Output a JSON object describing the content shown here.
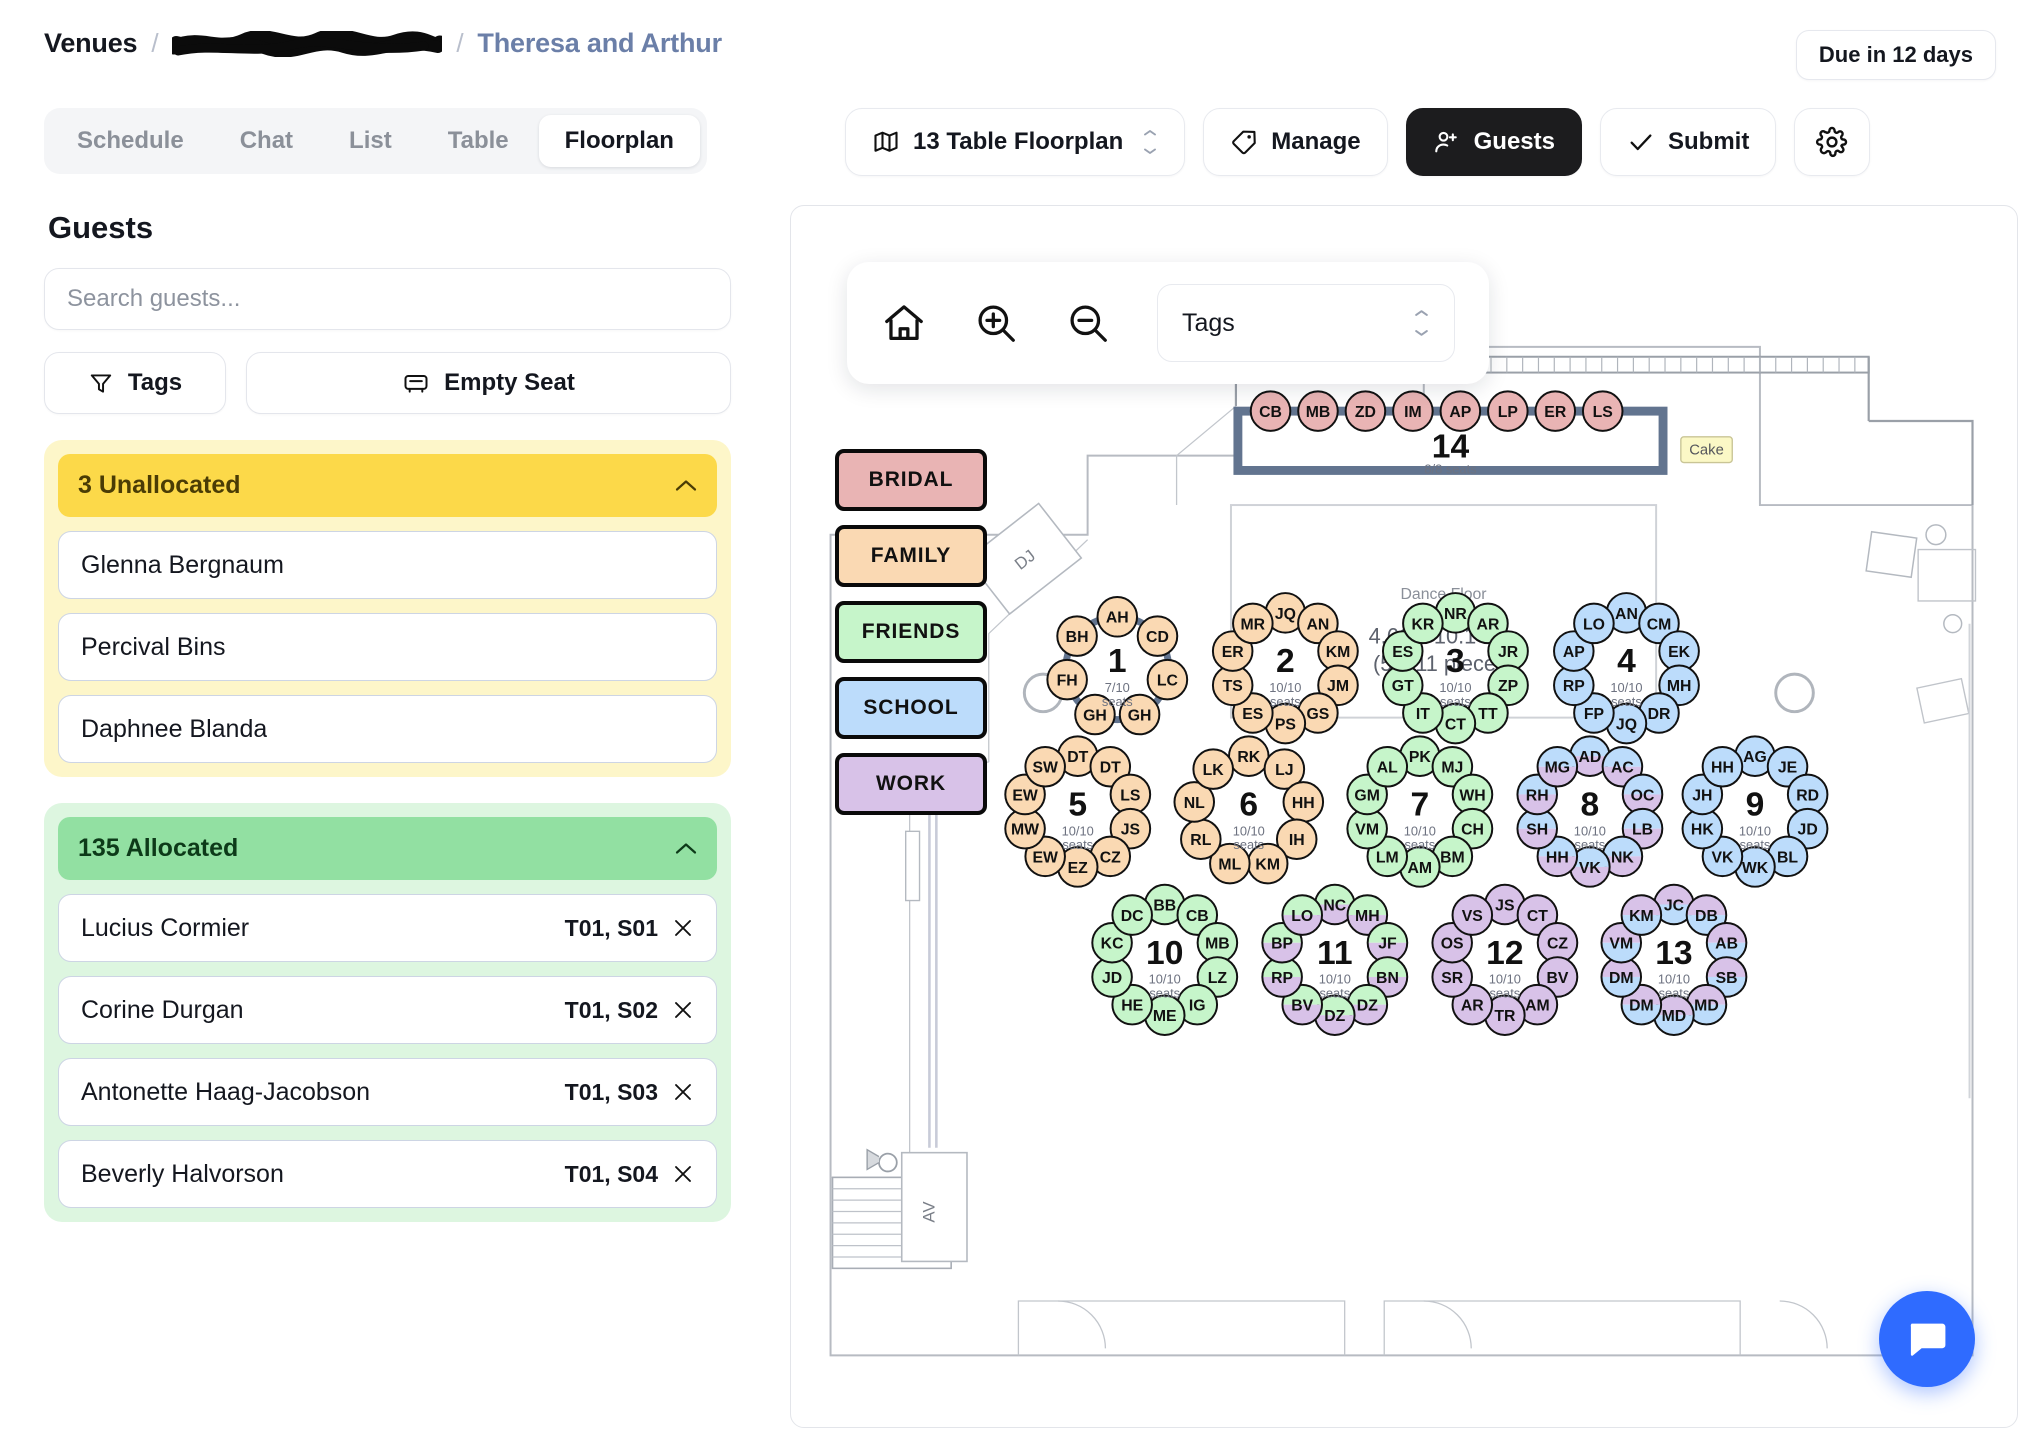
{
  "header": {
    "breadcrumb": {
      "root": "Venues",
      "separator": "/",
      "redacted_label": "",
      "current": "Theresa and Arthur"
    },
    "due_badge": "Due in 12 days"
  },
  "tabs": [
    {
      "label": "Schedule",
      "active": false
    },
    {
      "label": "Chat",
      "active": false
    },
    {
      "label": "List",
      "active": false
    },
    {
      "label": "Table",
      "active": false
    },
    {
      "label": "Floorplan",
      "active": true
    }
  ],
  "toolbar": {
    "floorplan_select": "13 Table Floorplan",
    "manage": "Manage",
    "guests": "Guests",
    "submit": "Submit",
    "settings_icon": "gear-icon"
  },
  "sidebar": {
    "title": "Guests",
    "search_placeholder": "Search guests...",
    "search_value": "",
    "tags_button": "Tags",
    "empty_seat_button": "Empty Seat",
    "unallocated": {
      "header": "3 Unallocated",
      "count": 3,
      "guests": [
        {
          "name": "Glenna Bergnaum"
        },
        {
          "name": "Percival Bins"
        },
        {
          "name": "Daphnee Blanda"
        }
      ]
    },
    "allocated": {
      "header": "135 Allocated",
      "count": 135,
      "guests": [
        {
          "name": "Lucius Cormier",
          "seat": "T01, S01"
        },
        {
          "name": "Corine Durgan",
          "seat": "T01, S02"
        },
        {
          "name": "Antonette Haag-Jacobson",
          "seat": "T01, S03"
        },
        {
          "name": "Beverly Halvorson",
          "seat": "T01, S04"
        }
      ]
    }
  },
  "floorplan": {
    "toolbar": {
      "home_icon": "home-icon",
      "zoom_in_icon": "zoom-in-icon",
      "zoom_out_icon": "zoom-out-icon",
      "tags_select": "Tags"
    },
    "legend": [
      {
        "label": "BRIDAL",
        "color": "#e9b4b4"
      },
      {
        "label": "FAMILY",
        "color": "#fad9b3"
      },
      {
        "label": "FRIENDS",
        "color": "#c6f5ca"
      },
      {
        "label": "SCHOOL",
        "color": "#bcdcfb"
      },
      {
        "label": "WORK",
        "color": "#d8c2e8"
      }
    ],
    "room_labels": [
      {
        "text": "DJ"
      },
      {
        "text": "AV"
      },
      {
        "text": "Cake"
      }
    ],
    "dance_floor": {
      "title": "Dance Floor",
      "dimensions": "4.61 x 10.142m",
      "pieces": "(5 x 11 pieces)"
    },
    "tables": [
      {
        "number": "1",
        "seats_label": "7/10 seats",
        "filled": 7,
        "capacity": 10,
        "shape": "round",
        "seats": [
          "AH",
          "CD",
          "LC",
          "GH",
          "GH",
          "FH",
          "BH"
        ],
        "colors": [
          "#fad9b3"
        ]
      },
      {
        "number": "2",
        "seats_label": "10/10 seats",
        "filled": 10,
        "capacity": 10,
        "shape": "round",
        "seats": [
          "JQ",
          "AN",
          "KM",
          "JM",
          "GS",
          "PS",
          "ES",
          "TS",
          "ER",
          "MR"
        ],
        "colors": [
          "#fad9b3"
        ]
      },
      {
        "number": "3",
        "seats_label": "10/10 seats",
        "filled": 10,
        "capacity": 10,
        "shape": "round",
        "seats": [
          "NR",
          "AR",
          "JR",
          "ZP",
          "TT",
          "CT",
          "IT",
          "GT",
          "ES",
          "KR"
        ],
        "colors": [
          "#c6f5ca"
        ]
      },
      {
        "number": "4",
        "seats_label": "10/10 seats",
        "filled": 10,
        "capacity": 10,
        "shape": "round",
        "seats": [
          "AN",
          "CM",
          "EK",
          "MH",
          "DR",
          "JQ",
          "FP",
          "RP",
          "AP",
          "LO"
        ],
        "colors": [
          "#bcdcfb"
        ]
      },
      {
        "number": "5",
        "seats_label": "10/10 seats",
        "filled": 10,
        "capacity": 10,
        "shape": "round",
        "seats": [
          "DT",
          "DT",
          "LS",
          "JS",
          "CZ",
          "EZ",
          "EW",
          "MW",
          "EW",
          "SW"
        ],
        "colors": [
          "#fad9b3"
        ]
      },
      {
        "number": "6",
        "seats_label": "10/10 seats",
        "filled": 10,
        "capacity": 10,
        "shape": "round",
        "seats": [
          "RK",
          "LJ",
          "HH",
          "IH",
          "KM",
          "ML",
          "RL",
          "NL",
          "LK"
        ],
        "colors": [
          "#fad9b3"
        ]
      },
      {
        "number": "7",
        "seats_label": "10/10 seats",
        "filled": 10,
        "capacity": 10,
        "shape": "round",
        "seats": [
          "PK",
          "MJ",
          "WH",
          "CH",
          "BM",
          "AM",
          "LM",
          "VM",
          "GM",
          "AL"
        ],
        "colors": [
          "#c6f5ca"
        ]
      },
      {
        "number": "8",
        "seats_label": "10/10 seats",
        "filled": 10,
        "capacity": 10,
        "shape": "round",
        "seats": [
          "AD",
          "AC",
          "OC",
          "LB",
          "NK",
          "VK",
          "HH",
          "SH",
          "RH",
          "MG"
        ],
        "colors": [
          "#bcdcfb",
          "#d8c2e8"
        ]
      },
      {
        "number": "9",
        "seats_label": "10/10 seats",
        "filled": 10,
        "capacity": 10,
        "shape": "round",
        "seats": [
          "AG",
          "JE",
          "RD",
          "JD",
          "BL",
          "WK",
          "VK",
          "HK",
          "JH",
          "HH"
        ],
        "colors": [
          "#bcdcfb"
        ]
      },
      {
        "number": "10",
        "seats_label": "10/10 seats",
        "filled": 10,
        "capacity": 10,
        "shape": "round",
        "seats": [
          "BB",
          "CB",
          "MB",
          "LZ",
          "IG",
          "ME",
          "HE",
          "JD",
          "KC",
          "DC"
        ],
        "colors": [
          "#c6f5ca"
        ]
      },
      {
        "number": "11",
        "seats_label": "10/10 seats",
        "filled": 10,
        "capacity": 10,
        "shape": "round",
        "seats": [
          "NC",
          "MH",
          "JF",
          "BN",
          "DZ",
          "DZ",
          "BV",
          "RP",
          "BP",
          "LO"
        ],
        "colors": [
          "#c6f5ca",
          "#d8c2e8"
        ]
      },
      {
        "number": "12",
        "seats_label": "10/10 seats",
        "filled": 10,
        "capacity": 10,
        "shape": "round",
        "seats": [
          "JS",
          "CT",
          "CZ",
          "BV",
          "AM",
          "TR",
          "AR",
          "SR",
          "OS",
          "VS"
        ],
        "colors": [
          "#d8c2e8"
        ]
      },
      {
        "number": "13",
        "seats_label": "10/10 seats",
        "filled": 10,
        "capacity": 10,
        "shape": "round",
        "seats": [
          "JC",
          "DB",
          "AB",
          "SB",
          "MD",
          "MD",
          "DM",
          "DM",
          "VM",
          "KM"
        ],
        "colors": [
          "#d8c2e8",
          "#bcdcfb"
        ]
      },
      {
        "number": "14",
        "seats_label": "8/8 seats",
        "filled": 8,
        "capacity": 8,
        "shape": "head",
        "seats": [
          "CB",
          "MB",
          "ZD",
          "IM",
          "AP",
          "LP",
          "ER",
          "LS"
        ],
        "colors": [
          "#e9b4b4"
        ]
      }
    ]
  },
  "chat_widget": {
    "icon": "chat-bubble-icon",
    "color": "#2f6bff"
  }
}
